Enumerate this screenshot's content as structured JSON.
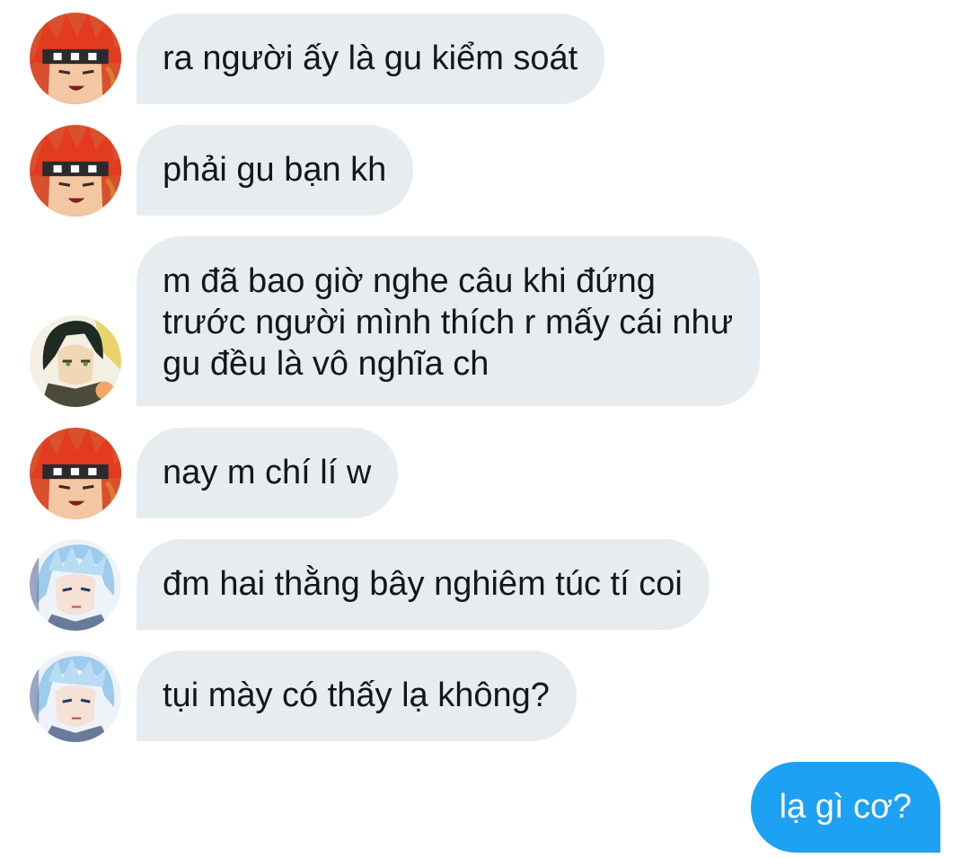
{
  "messages": [
    {
      "sender": "red-hair",
      "lines": [
        "ra người ấy là gu kiểm soát"
      ]
    },
    {
      "sender": "red-hair",
      "lines": [
        "phải gu bạn kh"
      ]
    },
    {
      "sender": "dark-hair",
      "lines": [
        "m đã bao giờ nghe câu khi đứng",
        "trước người mình thích r mấy cái như",
        "gu đều là vô nghĩa ch"
      ]
    },
    {
      "sender": "red-hair",
      "lines": [
        "nay m chí lí w"
      ]
    },
    {
      "sender": "blue-hair",
      "lines": [
        "đm hai thằng bây nghiêm túc tí coi"
      ]
    },
    {
      "sender": "blue-hair",
      "lines": [
        "tụi mày có thấy lạ không?"
      ]
    },
    {
      "sender": "me",
      "lines": [
        "lạ gì cơ?"
      ]
    }
  ],
  "colors": {
    "received_bubble": "#e6ecf0",
    "sent_bubble": "#1da1f2",
    "text": "#14171a"
  },
  "icons": [
    "red-hair-avatar-icon",
    "dark-hair-avatar-icon",
    "blue-hair-avatar-icon"
  ]
}
